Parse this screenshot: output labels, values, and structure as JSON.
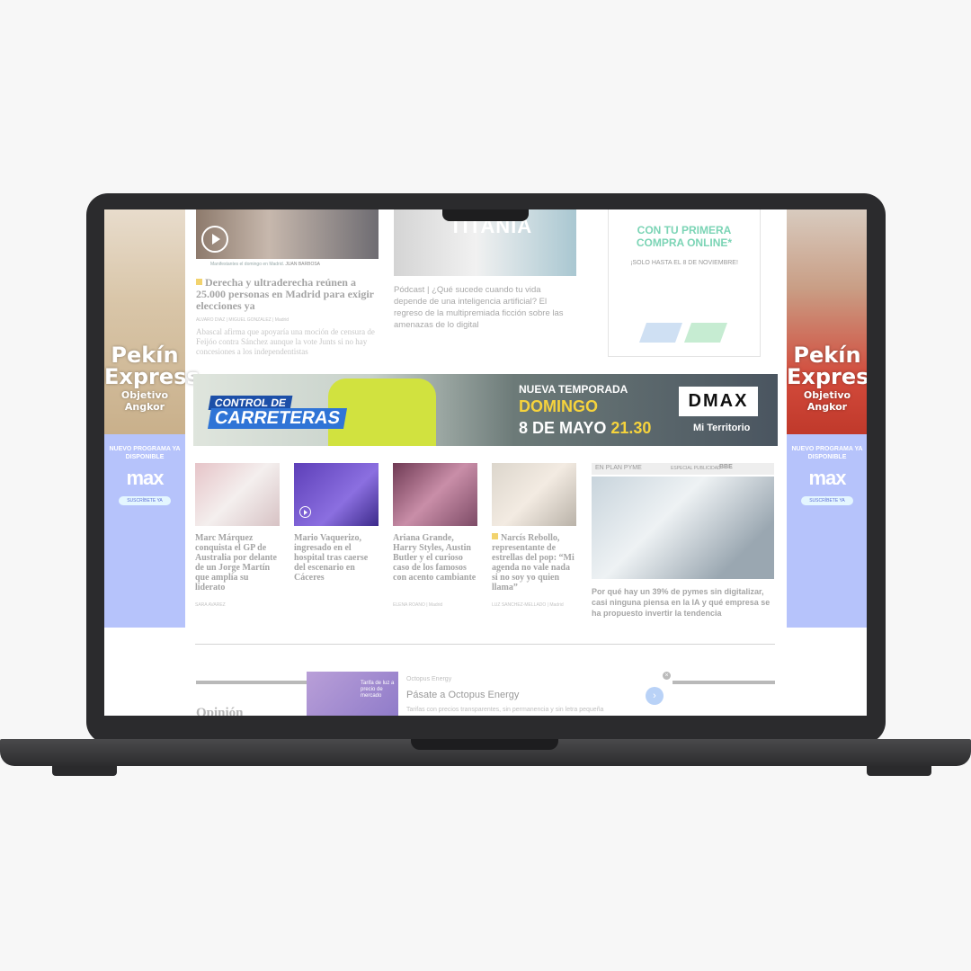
{
  "left_ad": {
    "title1": "Pekín",
    "title2": "Express",
    "subtitle": "Objetivo Angkor",
    "promo": "NUEVO PROGRAMA YA DISPONIBLE",
    "logo": "max",
    "cta": "SUSCRÍBETE YA"
  },
  "right_ad": {
    "title1": "Pekín",
    "title2": "Express",
    "subtitle": "Objetivo Angkor",
    "promo": "NUEVO PROGRAMA YA DISPONIBLE",
    "logo": "max",
    "cta": "SUSCRÍBETE YA"
  },
  "top_story": {
    "photo_credit": "Manifestantes el domingo en Madrid.",
    "photo_author": "JUAN BARBOSA",
    "headline": "Derecha y ultraderecha reúnen a 25.000 personas en Madrid para exigir elecciones ya",
    "byline": "ALVARO DIAZ | MIGUEL GONZALEZ | Madrid",
    "summary": "Abascal afirma que apoyaría una moción de censura de Feijóo contra Sánchez aunque la vote Junts si no hay concesiones a los independentistas"
  },
  "podcast_story": {
    "image_text": "TITANIA",
    "text": "Pódcast | ¿Qué sucede cuando tu vida depende de una inteligencia artificial? El regreso de la multipremiada ficción sobre las amenazas de lo digital"
  },
  "store_ad": {
    "line1": "CON TU PRIMERA",
    "line2": "COMPRA ONLINE*",
    "note": "¡SOLO HASTA EL 8 DE NOVIEMBRE!"
  },
  "banner": {
    "show1": "CONTROL DE",
    "show2": "CARRETERAS",
    "new_season": "NUEVA TEMPORADA",
    "day": "DOMINGO",
    "date": "8 DE MAYO",
    "time": "21.30",
    "channel": "DMAX",
    "tagline": "Mi Territorio"
  },
  "cards": [
    {
      "title": "Marc Márquez conquista el GP de Australia por delante de un Jorge Martín que amplía su liderato",
      "author": "SARA AVAREZ"
    },
    {
      "title": "Mario Vaquerizo, ingresado en el hospital tras caerse del escenario en Cáceres",
      "author": ""
    },
    {
      "title": "Ariana Grande, Harry Styles, Austin Butler y el curioso caso de los famosos con acento cambiante",
      "author": "ELENA ROANO | Madrid"
    },
    {
      "title": "Narcís Rebollo, representante de estrellas del pop: “Mi agenda no vale nada si no soy yo quien llama”",
      "author": "LUZ SANCHEZ-MELLADO | Madrid"
    }
  ],
  "pyme": {
    "section": "EN PLAN PYME",
    "sponsored": "ESPECIAL PUBLICIDAD",
    "brand": "BBE",
    "title": "Por qué hay un 39% de pymes sin digitalizar, casi ninguna piensa en la IA y qué empresa se ha propuesto invertir la tendencia"
  },
  "octopus_ad": {
    "sponsor": "Octopus Energy",
    "headline": "Pásate a Octopus Energy",
    "body": "Tarifas con precios transparentes, sin permanencia y sin letra pequeña",
    "image_text": "Tarifa de luz a precio de mercado"
  },
  "opinion": {
    "label": "Opinión"
  }
}
